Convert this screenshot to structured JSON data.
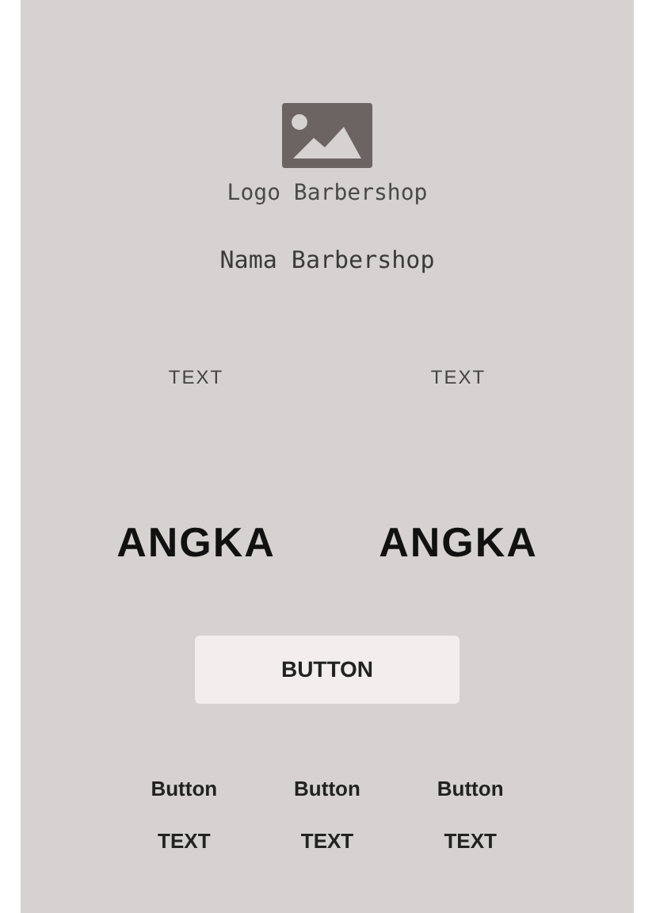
{
  "logo": {
    "label": "Logo Barbershop"
  },
  "name": "Nama Barbershop",
  "stats": [
    {
      "label": "TEXT",
      "value": "ANGKA"
    },
    {
      "label": "TEXT",
      "value": "ANGKA"
    }
  ],
  "main_button": "BUTTON",
  "actions": [
    {
      "button": "Button",
      "text": "TEXT"
    },
    {
      "button": "Button",
      "text": "TEXT"
    },
    {
      "button": "Button",
      "text": "TEXT"
    }
  ]
}
